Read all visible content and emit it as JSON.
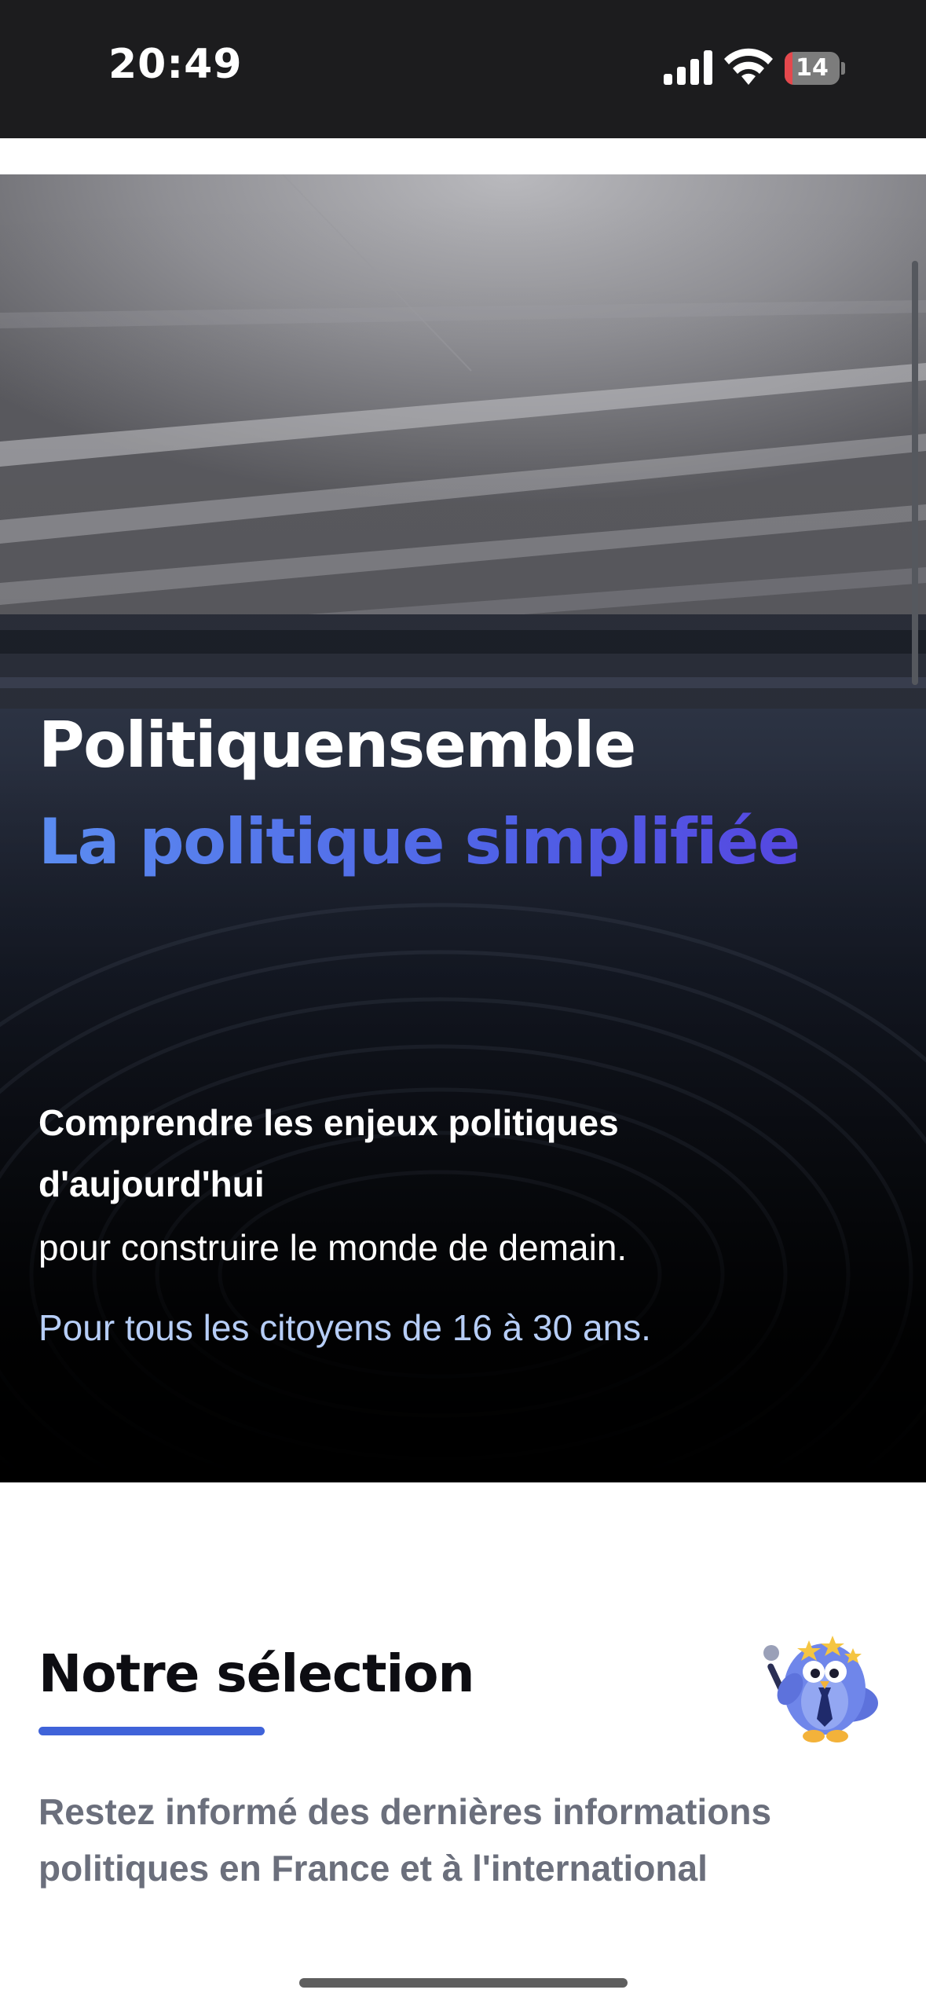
{
  "status_bar": {
    "time": "20:49",
    "battery_level": "14",
    "battery_fraction": 0.14,
    "signal_icon": "cellular-signal-icon",
    "wifi_icon": "wifi-icon"
  },
  "hero": {
    "title": "Politiquensemble",
    "subtitle": "La politique simplifiée",
    "lead": "Comprendre les enjeux politiques d'aujourd'hui",
    "lead_continuation": "pour construire le monde de demain.",
    "audience": "Pour tous les citoyens de 16 à 30 ans."
  },
  "selection": {
    "title": "Notre sélection",
    "description": "Restez informé des dernières informations politiques en France et à l'international",
    "mascot_icon": "owl-mascot-icon"
  },
  "colors": {
    "accent": "#3f63d9",
    "subtitle_gradient_start": "#5b8cf0",
    "subtitle_gradient_end": "#5547e0",
    "audience_text": "#b6cdf6",
    "description_text": "#6b6f7c",
    "battery_low": "#e5484d"
  }
}
